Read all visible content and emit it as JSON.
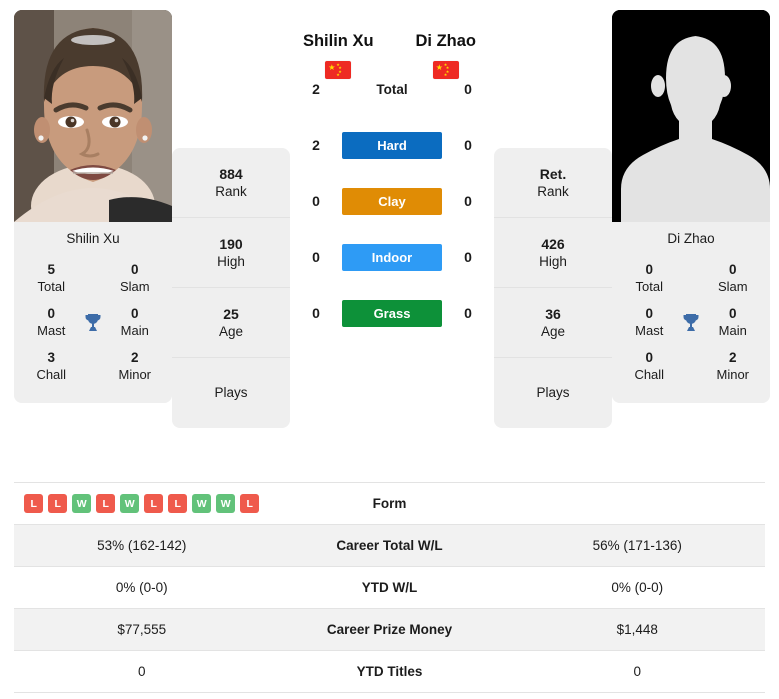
{
  "players": {
    "left": {
      "name": "Shilin Xu",
      "photo_caption": "Shilin Xu",
      "flag": "china-flag",
      "photo_type": "portrait",
      "rank": "884",
      "rank_label": "Rank",
      "high": "190",
      "high_label": "High",
      "age": "25",
      "age_label": "Age",
      "plays_label": "Plays",
      "plays_value": "",
      "titles": {
        "total": "5",
        "total_label": "Total",
        "slam": "0",
        "slam_label": "Slam",
        "mast": "0",
        "mast_label": "Mast",
        "main": "0",
        "main_label": "Main",
        "chall": "3",
        "chall_label": "Chall",
        "minor": "2",
        "minor_label": "Minor"
      }
    },
    "right": {
      "name": "Di Zhao",
      "photo_caption": "Di Zhao",
      "flag": "china-flag",
      "photo_type": "placeholder-silhouette",
      "rank": "Ret.",
      "rank_label": "Rank",
      "high": "426",
      "high_label": "High",
      "age": "36",
      "age_label": "Age",
      "plays_label": "Plays",
      "plays_value": "",
      "titles": {
        "total": "0",
        "total_label": "Total",
        "slam": "0",
        "slam_label": "Slam",
        "mast": "0",
        "mast_label": "Mast",
        "main": "0",
        "main_label": "Main",
        "chall": "0",
        "chall_label": "Chall",
        "minor": "2",
        "minor_label": "Minor"
      }
    }
  },
  "h2h": {
    "rows": [
      {
        "left": "2",
        "label": "Total",
        "right": "0",
        "color": "",
        "plain": true
      },
      {
        "left": "2",
        "label": "Hard",
        "right": "0",
        "color": "#0b6cc0",
        "plain": false
      },
      {
        "left": "0",
        "label": "Clay",
        "right": "0",
        "color": "#e08c05",
        "plain": false
      },
      {
        "left": "0",
        "label": "Indoor",
        "right": "0",
        "color": "#2e9bf5",
        "plain": false
      },
      {
        "left": "0",
        "label": "Grass",
        "right": "0",
        "color": "#0d9139",
        "plain": false
      }
    ]
  },
  "stats_table": {
    "form_row": {
      "label": "Form",
      "left_form": [
        "L",
        "L",
        "W",
        "L",
        "W",
        "L",
        "L",
        "W",
        "W",
        "L"
      ],
      "right_form": []
    },
    "rows": [
      {
        "left": "53% (162-142)",
        "label": "Career Total W/L",
        "right": "56% (171-136)"
      },
      {
        "left": "0% (0-0)",
        "label": "YTD W/L",
        "right": "0% (0-0)"
      },
      {
        "left": "$77,555",
        "label": "Career Prize Money",
        "right": "$1,448"
      },
      {
        "left": "0",
        "label": "YTD Titles",
        "right": "0"
      }
    ]
  },
  "colors": {
    "hard": "#0b6cc0",
    "clay": "#e08c05",
    "indoor": "#2e9bf5",
    "grass": "#0d9139",
    "win": "#62c27a",
    "loss": "#ef5a4c",
    "trophy": "#3d6ca8",
    "card_bg": "#efefef"
  }
}
